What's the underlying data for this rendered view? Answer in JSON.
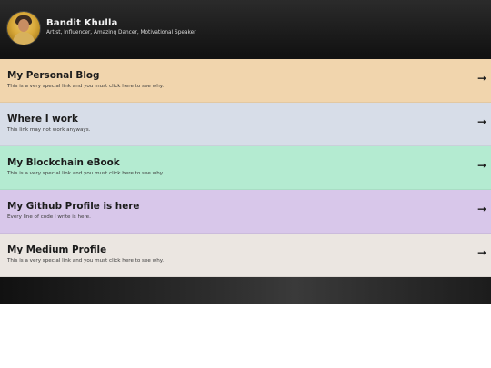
{
  "profile": {
    "name": "Bandit Khulla",
    "tagline": "Artist, Influencer, Amazing Dancer, Motivational Speaker",
    "avatar_icon": "avatar-photo"
  },
  "links": [
    {
      "title": "My Personal Blog",
      "description": "This is a very special link and you must click here to see why.",
      "color": "#f1d5ad",
      "icon": "arrow-right-icon"
    },
    {
      "title": "Where I work",
      "description": "This link may not work anyways.",
      "color": "#d7dde8",
      "icon": "arrow-right-icon"
    },
    {
      "title": "My Blockchain eBook",
      "description": "This is a very special link and you must click here to see why.",
      "color": "#b4ebd1",
      "icon": "arrow-right-icon"
    },
    {
      "title": "My Github Profile is here",
      "description": "Every line of code I write is here.",
      "color": "#d8c7ea",
      "icon": "arrow-right-icon"
    },
    {
      "title": "My Medium Profile",
      "description": "This is a very special link and you must click here to see why.",
      "color": "#ebe6e1",
      "icon": "arrow-right-icon"
    }
  ],
  "theme": {
    "background_dark": "#111111",
    "text_light": "#f2f2f2",
    "text_dark": "#1b1b1b"
  }
}
